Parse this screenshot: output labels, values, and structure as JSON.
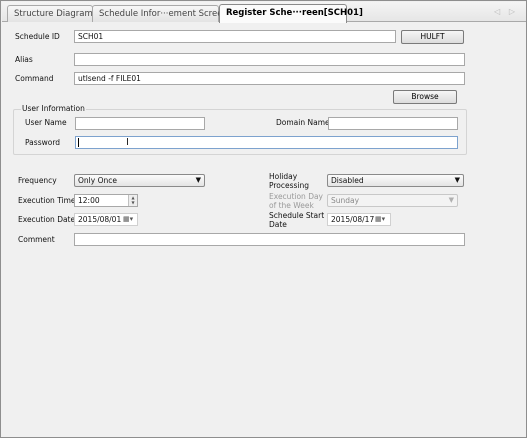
{
  "tabs": [
    {
      "label": "Structure Diagram"
    },
    {
      "label": "Schedule Infor···ement Screen"
    },
    {
      "label": "Register Sche···reen[SCH01]"
    }
  ],
  "nav_arrows": "◁ ▷",
  "form": {
    "schedule_id_label": "Schedule ID",
    "schedule_id_value": "SCH01",
    "hulft_button": "HULFT",
    "alias_label": "Alias",
    "alias_value": "",
    "command_label": "Command",
    "command_value": "utlsend -f FILE01",
    "browse_button": "Browse",
    "user_info_title": "User Information",
    "user_name_label": "User Name",
    "user_name_value": "",
    "domain_name_label": "Domain Name",
    "domain_name_value": "",
    "password_label": "Password",
    "password_value": "",
    "frequency_label": "Frequency",
    "frequency_value": "Only Once",
    "holiday_label_1": "Holiday",
    "holiday_label_2": "Processing",
    "holiday_value": "Disabled",
    "exec_time_label": "Execution Time",
    "exec_time_value": "12:00",
    "exec_day_label_1": "Execution Day",
    "exec_day_label_2": "of the Week",
    "exec_day_value": "Sunday",
    "exec_date_label": "Execution Date",
    "exec_date_value": "2015/08/01",
    "start_date_label_1": "Schedule Start",
    "start_date_label_2": "Date",
    "start_date_value": "2015/08/17",
    "comment_label": "Comment",
    "comment_value": ""
  },
  "icons": {
    "dropdown": "▼",
    "spin_up": "▲",
    "spin_down": "▼",
    "calendar": "▦▾",
    "ibeam": "I"
  }
}
